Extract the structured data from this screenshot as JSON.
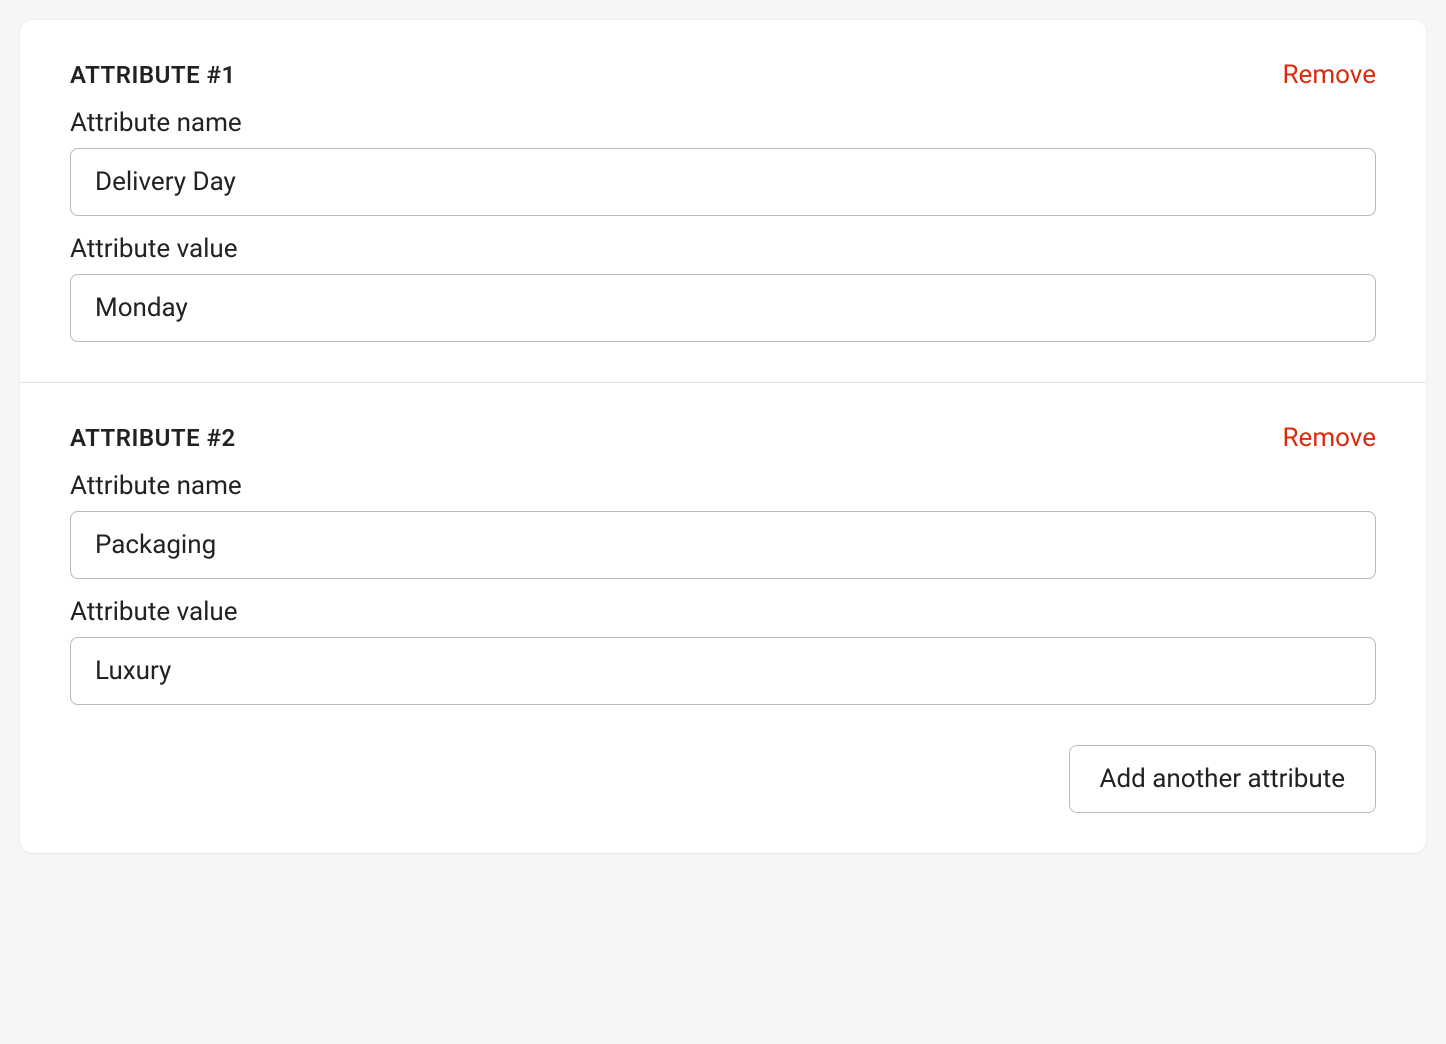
{
  "labels": {
    "attribute_name": "Attribute name",
    "attribute_value": "Attribute value",
    "remove": "Remove",
    "add_another": "Add another attribute"
  },
  "attributes": [
    {
      "title": "ATTRIBUTE #1",
      "name": "Delivery Day",
      "value": "Monday"
    },
    {
      "title": "ATTRIBUTE #2",
      "name": "Packaging",
      "value": "Luxury"
    }
  ]
}
